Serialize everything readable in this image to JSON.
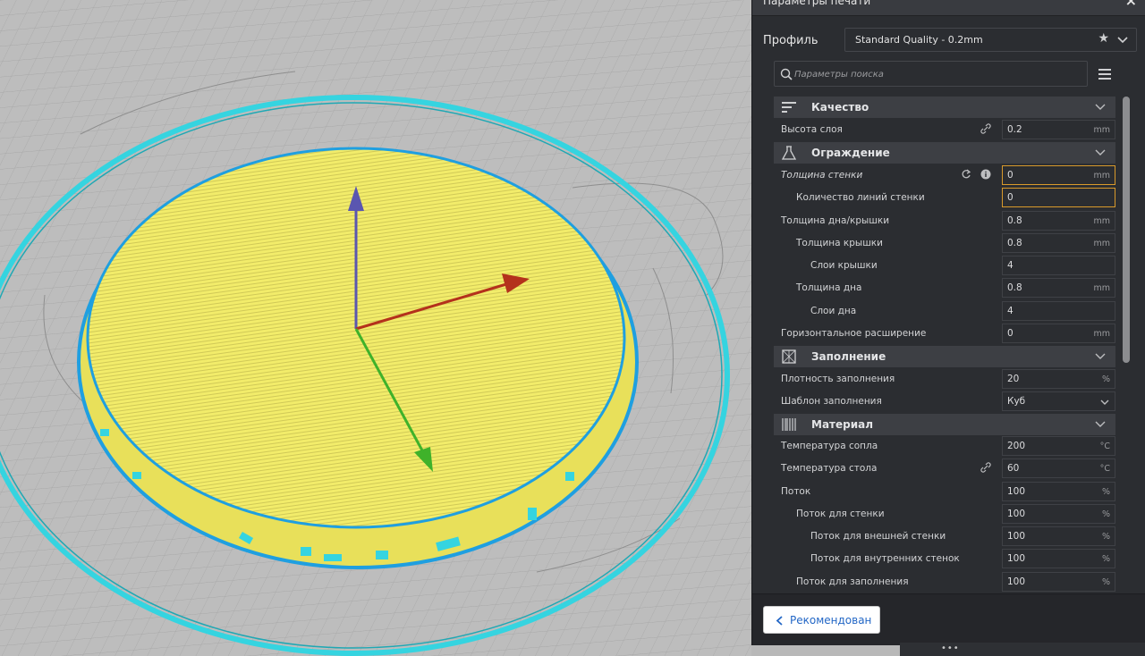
{
  "panel": {
    "title": "Параметры печати",
    "close_glyph": "×",
    "profile_label": "Профиль",
    "profile_value": "Standard Quality - 0.2mm",
    "search_placeholder": "Параметры поиска",
    "footer_button": "Рекомендован"
  },
  "categories": [
    {
      "label": "Качество",
      "icon": "quality-icon"
    },
    {
      "label": "Ограждение",
      "icon": "shell-icon"
    },
    {
      "label": "Заполнение",
      "icon": "infill-icon"
    },
    {
      "label": "Материал",
      "icon": "material-icon"
    }
  ],
  "settings": [
    {
      "label": "Высота слоя",
      "value": "0.2",
      "unit": "mm",
      "icon": "link-icon"
    },
    {
      "label": "Толщина стенки",
      "value": "0",
      "unit": "mm",
      "icon": "reset-icon",
      "icon2": "info-icon"
    },
    {
      "label": "Количество линий стенки",
      "value": "0",
      "unit": ""
    },
    {
      "label": "Толщина дна/крышки",
      "value": "0.8",
      "unit": "mm"
    },
    {
      "label": "Толщина крышки",
      "value": "0.8",
      "unit": "mm"
    },
    {
      "label": "Слои крышки",
      "value": "4",
      "unit": ""
    },
    {
      "label": "Толщина дна",
      "value": "0.8",
      "unit": "mm"
    },
    {
      "label": "Слои дна",
      "value": "4",
      "unit": ""
    },
    {
      "label": "Горизонтальное расширение",
      "value": "0",
      "unit": "mm"
    },
    {
      "label": "Плотность заполнения",
      "value": "20",
      "unit": "%"
    },
    {
      "label": "Шаблон заполнения",
      "value": "Куб",
      "unit": ""
    },
    {
      "label": "Температура сопла",
      "value": "200",
      "unit": "°C"
    },
    {
      "label": "Температура стола",
      "value": "60",
      "unit": "°C",
      "icon": "link-icon"
    },
    {
      "label": "Поток",
      "value": "100",
      "unit": "%"
    },
    {
      "label": "Поток для стенки",
      "value": "100",
      "unit": "%"
    },
    {
      "label": "Поток для внешней стенки",
      "value": "100",
      "unit": "%"
    },
    {
      "label": "Поток для внутренних стенок",
      "value": "100",
      "unit": "%"
    },
    {
      "label": "Поток для заполнения",
      "value": "100",
      "unit": "%"
    }
  ],
  "colors": {
    "panel_bg": "#2b2d31",
    "category_bg": "#3d3f44",
    "active_field_border": "#d99a2b",
    "model_yellow": "#f2ec6a",
    "skirt_cyan": "#35d4e0",
    "axis_x": "#b4311c",
    "axis_y": "#3fb22a",
    "axis_z": "#5a56b0",
    "link_blue": "#2367c6"
  }
}
